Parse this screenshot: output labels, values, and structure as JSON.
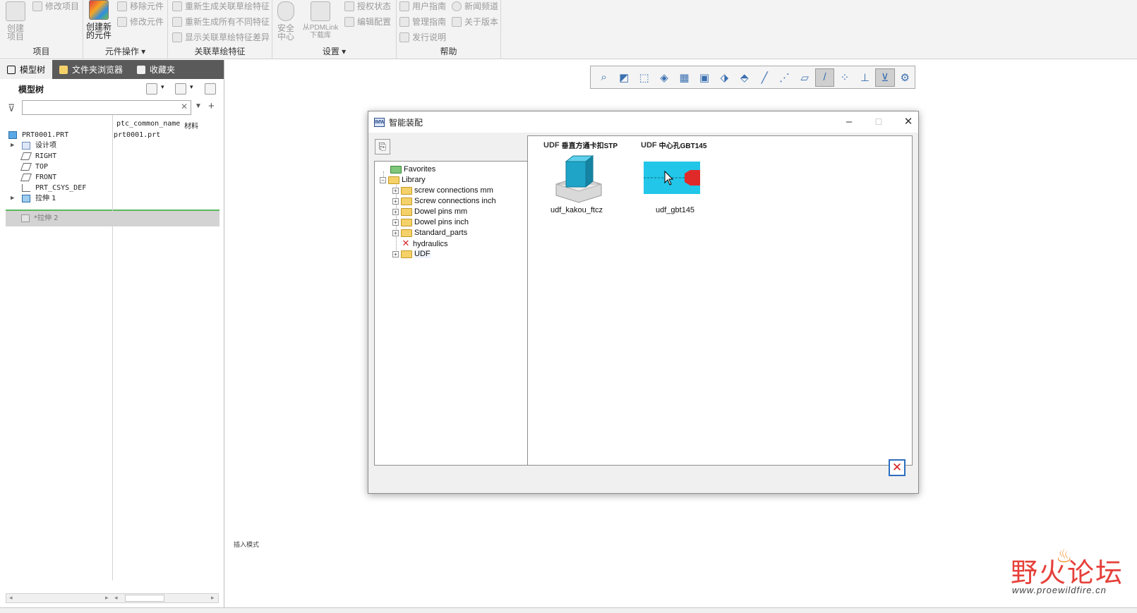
{
  "ribbon": {
    "project_group": {
      "label": "项目",
      "create_label": "创建\n项目",
      "modify_label": "修改项目"
    },
    "component_group": {
      "label": "元件操作",
      "create_new_label": "创建新\n的元件",
      "remove_label": "移除元件",
      "modify_label": "修改元件"
    },
    "sketch_group": {
      "label": "关联草绘特征",
      "item1": "重新生成关联草绘特征",
      "item2": "重新生成所有不同特征",
      "item3": "显示关联草绘特征差异"
    },
    "settings_group": {
      "label": "设置",
      "security_label": "安全\n中心",
      "pdmlink_label": "从PDMLink\n下载库",
      "license_label": "授权状态",
      "config_label": "编辑配置"
    },
    "help_group": {
      "label": "帮助",
      "user_guide": "用户指南",
      "news": "新闻频道",
      "admin_guide": "管理指南",
      "about": "关于版本",
      "release_notes": "发行说明"
    }
  },
  "left_panel": {
    "tabs": [
      {
        "label": "模型树"
      },
      {
        "label": "文件夹浏览器"
      },
      {
        "label": "收藏夹"
      }
    ],
    "header_title": "模型树",
    "filter_placeholder": "",
    "columns": {
      "name_col": "ptc_common_name",
      "material_col": "材料"
    },
    "tree": [
      {
        "label": "PRT0001.PRT",
        "value": "prt0001.prt"
      },
      {
        "label": "设计项",
        "value": ""
      },
      {
        "label": "RIGHT",
        "value": ""
      },
      {
        "label": "TOP",
        "value": ""
      },
      {
        "label": "FRONT",
        "value": ""
      },
      {
        "label": "PRT_CSYS_DEF",
        "value": ""
      },
      {
        "label": "拉伸 1",
        "value": ""
      }
    ],
    "insert_row_label": "*拉伸 2"
  },
  "graphics": {
    "insert_mode_label": "插入模式"
  },
  "dialog": {
    "title": "智能装配",
    "library_tree": [
      {
        "label": "Favorites"
      },
      {
        "label": "Library"
      },
      {
        "label": "screw connections mm"
      },
      {
        "label": "Screw connections inch"
      },
      {
        "label": "Dowel pins mm"
      },
      {
        "label": "Dowel pins inch"
      },
      {
        "label": "Standard_parts"
      },
      {
        "label": "hydraulics"
      },
      {
        "label": "UDF"
      }
    ],
    "udf_items": [
      {
        "title": "垂直方通卡扣STP",
        "name": "udf_kakou_ftcz",
        "mark": "UDF"
      },
      {
        "title": "中心孔GBT145",
        "name": "udf_gbt145",
        "mark": "UDF"
      }
    ]
  },
  "watermark": {
    "text": "野火论坛",
    "url": "www.proewildfire.cn"
  },
  "colors": {
    "ribbon_bg": "#f3f3f3",
    "tab_bar": "#5a5a5a",
    "insert_line": "#5cb85c",
    "folder": "#f5d16a",
    "udf_cyan": "#22c6e8",
    "close_red": "#d72020",
    "watermark_red": "#e6403a"
  }
}
